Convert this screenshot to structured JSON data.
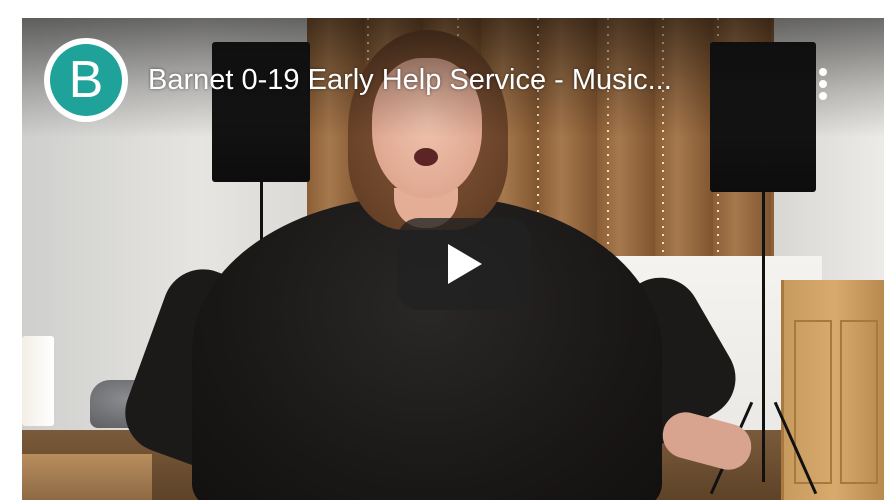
{
  "video": {
    "title": "Barnet 0-19 Early Help Service - Music...",
    "channel_avatar_letter": "B",
    "channel_avatar_color": "#1fa29a",
    "play_button_color": "#212121",
    "icons": {
      "play": "play-icon",
      "more": "more-vert-icon"
    }
  }
}
